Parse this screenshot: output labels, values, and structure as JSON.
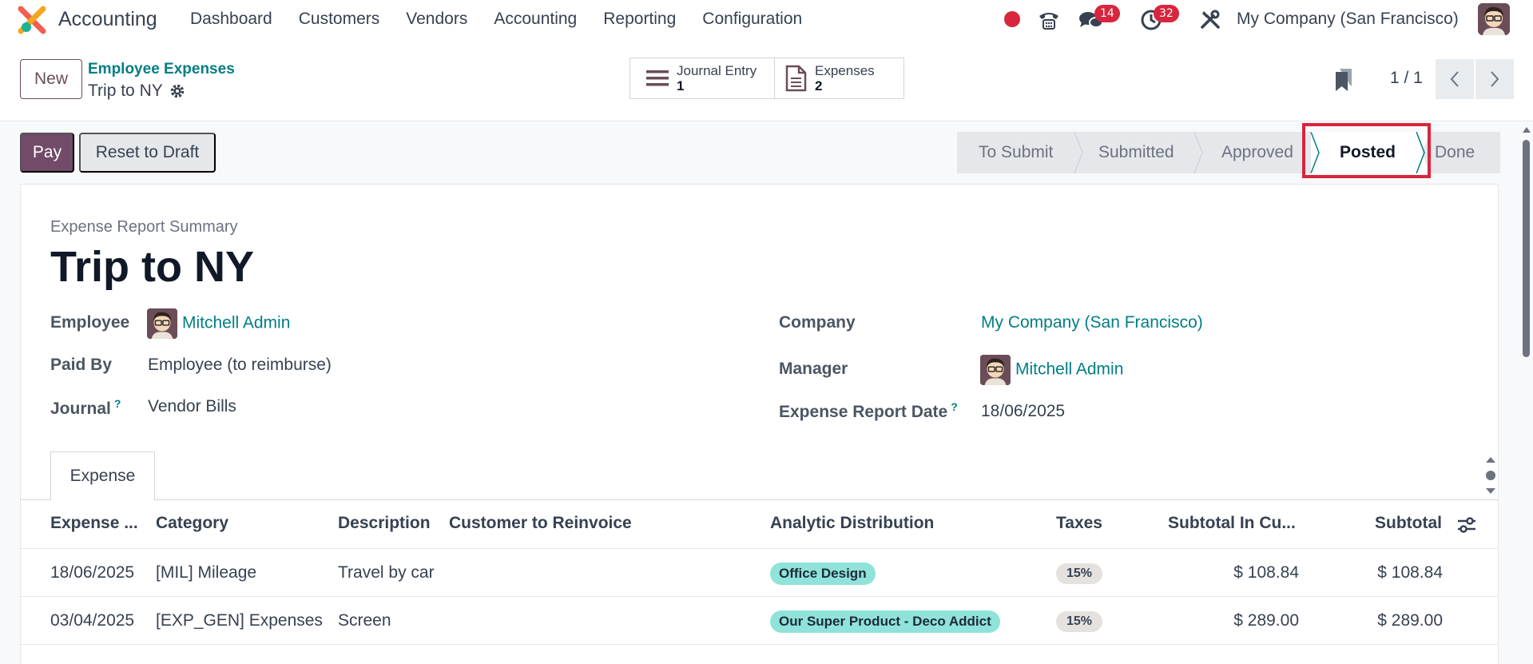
{
  "nav": {
    "app_name": "Accounting",
    "menu": [
      "Dashboard",
      "Customers",
      "Vendors",
      "Accounting",
      "Reporting",
      "Configuration"
    ],
    "messages_badge": "14",
    "activities_badge": "32",
    "company": "My Company (San Francisco)"
  },
  "control": {
    "new_label": "New",
    "breadcrumb_parent": "Employee Expenses",
    "breadcrumb_current": "Trip to NY",
    "smart_buttons": [
      {
        "label": "Journal Entry",
        "value": "1"
      },
      {
        "label": "Expenses",
        "value": "2"
      }
    ],
    "pager": "1 / 1"
  },
  "actions": {
    "pay_label": "Pay",
    "reset_label": "Reset to Draft"
  },
  "status_stages": [
    "To Submit",
    "Submitted",
    "Approved",
    "Posted",
    "Done"
  ],
  "status_current": "Posted",
  "form": {
    "subtitle": "Expense Report Summary",
    "title": "Trip to NY",
    "employee_label": "Employee",
    "employee_value": "Mitchell Admin",
    "paid_by_label": "Paid By",
    "paid_by_value": "Employee (to reimburse)",
    "journal_label": "Journal",
    "journal_value": "Vendor Bills",
    "company_label": "Company",
    "company_value": "My Company (San Francisco)",
    "manager_label": "Manager",
    "manager_value": "Mitchell Admin",
    "date_label": "Expense Report Date",
    "date_value": "18/06/2025",
    "help_mark": "?"
  },
  "tabs": [
    "Expense"
  ],
  "table": {
    "columns": [
      "Expense ...",
      "Category",
      "Description",
      "Customer to Reinvoice",
      "Analytic Distribution",
      "Taxes",
      "Subtotal In Cu...",
      "Subtotal"
    ],
    "rows": [
      {
        "date": "18/06/2025",
        "category": "[MIL] Mileage",
        "description": "Travel by car",
        "customer": "",
        "analytic": "Office Design",
        "tax": "15%",
        "subtotal_cur": "$ 108.84",
        "subtotal": "$ 108.84"
      },
      {
        "date": "03/04/2025",
        "category": "[EXP_GEN] Expenses",
        "description": "Screen",
        "customer": "",
        "analytic": "Our Super Product - Deco Addict",
        "tax": "15%",
        "subtotal_cur": "$ 289.00",
        "subtotal": "$ 289.00"
      }
    ]
  },
  "colors": {
    "brand": "#714b67",
    "link": "#017e84",
    "badge": "#d7263d",
    "analytic_tag": "#8fe3d9",
    "highlight": "#d7263d"
  }
}
